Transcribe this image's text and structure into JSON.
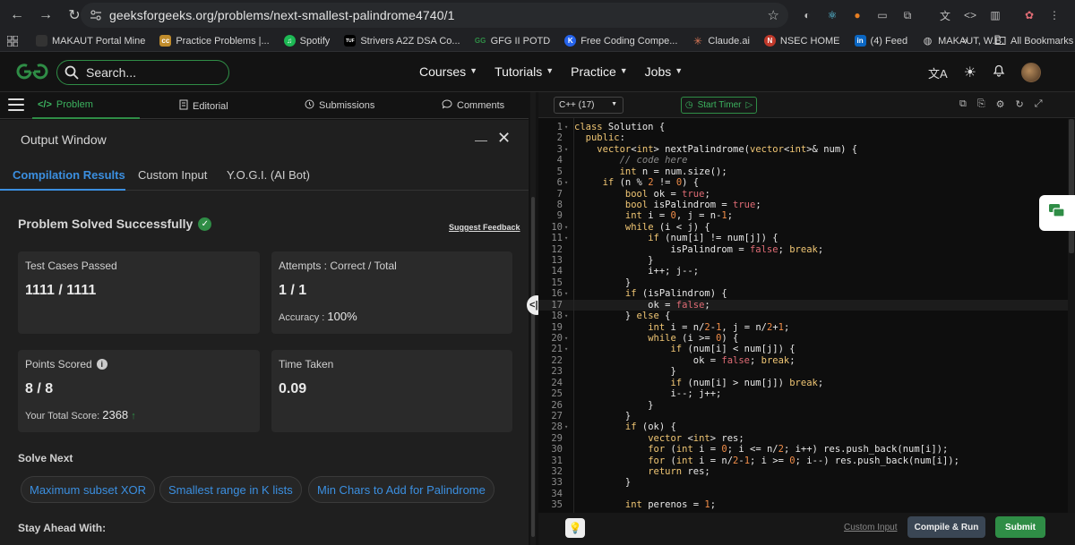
{
  "browser": {
    "url": "geeksforgeeks.org/problems/next-smallest-palindrome4740/1",
    "bookmarks": [
      {
        "label": "MAKAUT Portal Mine",
        "color": "#202124",
        "glyph": ""
      },
      {
        "label": "Practice Problems |...",
        "color": "#c08c2c",
        "glyph": "cc"
      },
      {
        "label": "Spotify",
        "color": "#1db954",
        "glyph": "♫"
      },
      {
        "label": "Strivers A2Z DSA Co...",
        "color": "#000000",
        "glyph": "TUF"
      },
      {
        "label": "GFG II POTD",
        "color": "#2f8d46",
        "glyph": "G"
      },
      {
        "label": "Free Coding Compe...",
        "color": "#2563eb",
        "glyph": "K"
      },
      {
        "label": "Claude.ai",
        "color": "#d97757",
        "glyph": "✳"
      },
      {
        "label": "NSEC HOME",
        "color": "#c0392b",
        "glyph": "N"
      },
      {
        "label": "(4) Feed",
        "color": "#0a66c2",
        "glyph": "in"
      },
      {
        "label": "MAKAUT, W.B.",
        "color": "#555555",
        "glyph": "◍"
      }
    ],
    "all_bookmarks": "All Bookmarks"
  },
  "header": {
    "search_placeholder": "Search...",
    "nav": [
      "Courses",
      "Tutorials",
      "Practice",
      "Jobs"
    ]
  },
  "problem_tabs": {
    "problem": "Problem",
    "editorial": "Editorial",
    "submissions": "Submissions",
    "comments": "Comments"
  },
  "output": {
    "title": "Output Window",
    "tabs": [
      "Compilation Results",
      "Custom Input",
      "Y.O.G.I. (AI Bot)"
    ],
    "result_title": "Problem Solved Successfully",
    "suggest_feedback": "Suggest Feedback",
    "test_cases_label": "Test Cases Passed",
    "test_cases_value": "1111 / 1111",
    "attempts_label": "Attempts : Correct / Total",
    "attempts_value": "1 / 1",
    "accuracy_label": "Accuracy :",
    "accuracy_value": "100%",
    "points_label": "Points Scored",
    "points_value": "8 / 8",
    "total_score_label": "Your Total Score:",
    "total_score_value": "2368",
    "time_label": "Time Taken",
    "time_value": "0.09",
    "solve_next": "Solve Next",
    "next_problems": [
      "Maximum subset XOR",
      "Smallest range in K lists",
      "Min Chars to Add for Palindrome"
    ],
    "stay_ahead": "Stay Ahead With:"
  },
  "editor": {
    "language": "C++ (17)",
    "start_timer": "Start Timer",
    "custom_input": "Custom Input",
    "compile_run": "Compile & Run",
    "submit": "Submit",
    "active_line": 17,
    "lines": [
      "class Solution {",
      "  public:",
      "    vector<int> nextPalindrome(vector<int>& num) {",
      "        // code here",
      "        int n = num.size();",
      "     if (n % 2 != 0) {",
      "         bool ok = true;",
      "         bool isPalindrom = true;",
      "         int i = 0, j = n-1;",
      "         while (i < j) {",
      "             if (num[i] != num[j]) {",
      "                 isPalindrom = false; break;",
      "             }",
      "             i++; j--;",
      "         }",
      "         if (isPalindrom) {",
      "             ok = false;",
      "         } else {",
      "             int i = n/2-1, j = n/2+1;",
      "             while (i >= 0) {",
      "                 if (num[i] < num[j]) {",
      "                     ok = false; break;",
      "                 }",
      "                 if (num[i] > num[j]) break;",
      "                 i--; j++;",
      "             }",
      "         }",
      "         if (ok) {",
      "             vector <int> res;",
      "             for (int i = 0; i <= n/2; i++) res.push_back(num[i]);",
      "             for (int i = n/2-1; i >= 0; i--) res.push_back(num[i]);",
      "             return res;",
      "         }",
      "",
      "         int perenos = 1;"
    ]
  }
}
